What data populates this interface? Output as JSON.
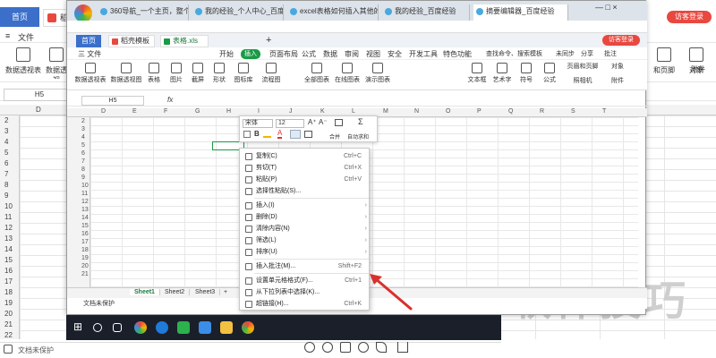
{
  "outer": {
    "tab_home": "首页",
    "tab_doc": "稻壳",
    "menu": [
      "文件"
    ],
    "ribbon": [
      "数据透视表",
      "数据透视"
    ],
    "namebox": "H5",
    "col_headers": [
      "D",
      "E"
    ],
    "row_numbers": [
      "2",
      "3",
      "4",
      "5",
      "6",
      "7",
      "8",
      "9",
      "10",
      "11",
      "12",
      "13",
      "14",
      "15",
      "16",
      "17",
      "18",
      "19",
      "20",
      "21",
      "22"
    ],
    "right_ribbon": [
      "和页脚",
      "对象",
      "附件"
    ],
    "user_badge": "访客登录",
    "status_doc": "文档未保护"
  },
  "viewer": {
    "watermark": "软件技巧",
    "bottom_icons": [
      "zoom-in-icon",
      "zoom-out-icon",
      "page-icon",
      "rotate-icon",
      "pen-icon",
      "download-icon"
    ]
  },
  "browser": {
    "tabs": [
      {
        "label": "360导航_一个主页，整个世界"
      },
      {
        "label": "我的经验_个人中心_百度经验"
      },
      {
        "label": "excel表格如何插入其他的表格"
      },
      {
        "label": "我的经验_百度经验"
      },
      {
        "label": "摘要编辑器_百度经验"
      }
    ],
    "win_controls": "—  □  ×"
  },
  "wps": {
    "tab_home": "首页",
    "tab_template": "稻壳模板",
    "tab_file": "表格.xls",
    "user_badge": "访客登录",
    "menu": [
      "三 文件",
      "开始",
      "插入",
      "页面布局",
      "公式",
      "数据",
      "审阅",
      "视图",
      "安全",
      "开发工具",
      "特色功能",
      "查找命令、搜索模板",
      "未同步",
      "分享",
      "批注"
    ],
    "ribbon": [
      "数据透视表",
      "数据透视图",
      "表格",
      "图片",
      "截屏",
      "形状",
      "图标库",
      "流程图",
      "全部图表",
      "在线图表",
      "演示图表",
      "文本框",
      "艺术字",
      "符号",
      "公式",
      "页眉和页脚",
      "对象",
      "照相机",
      "附件"
    ],
    "namebox": "H5",
    "fx": "fx",
    "col_headers": [
      "D",
      "E",
      "F",
      "G",
      "H",
      "I",
      "J",
      "K",
      "L",
      "M",
      "N",
      "O",
      "P",
      "Q",
      "R",
      "S",
      "T"
    ],
    "row_numbers": [
      "2",
      "3",
      "4",
      "5",
      "6",
      "7",
      "8",
      "9",
      "10",
      "11",
      "12",
      "13",
      "14",
      "15",
      "16",
      "17",
      "18",
      "19",
      "20",
      "21"
    ],
    "sheets": [
      "Sheet1",
      "Sheet2",
      "Sheet3"
    ],
    "status": "文档未保护"
  },
  "minitoolbar": {
    "font": "宋体",
    "size": "12",
    "grow": "A⁺",
    "shrink": "A⁻",
    "bold": "B",
    "merge": "合并",
    "autosum": "自动求和"
  },
  "context_menu": {
    "items": [
      {
        "label": "复制(C)",
        "shortcut": "Ctrl+C",
        "icon": "copy-icon"
      },
      {
        "label": "剪切(T)",
        "shortcut": "Ctrl+X",
        "icon": "cut-icon"
      },
      {
        "label": "粘贴(P)",
        "shortcut": "Ctrl+V",
        "icon": "paste-icon"
      },
      {
        "label": "选择性粘贴(S)...",
        "shortcut": "",
        "icon": "paste-special-icon"
      },
      {
        "label": "插入(I)",
        "shortcut": "",
        "icon": "insert-icon",
        "submenu": true
      },
      {
        "label": "删除(D)",
        "shortcut": "",
        "icon": "delete-icon",
        "submenu": true
      },
      {
        "label": "清除内容(N)",
        "shortcut": "",
        "icon": "clear-icon",
        "submenu": true
      },
      {
        "label": "筛选(L)",
        "shortcut": "",
        "icon": "filter-icon",
        "submenu": true
      },
      {
        "label": "排序(U)",
        "shortcut": "",
        "icon": "sort-icon",
        "submenu": true
      },
      {
        "label": "插入批注(M)...",
        "shortcut": "Shift+F2",
        "icon": "comment-icon"
      },
      {
        "label": "设置单元格格式(F)...",
        "shortcut": "Ctrl+1",
        "icon": "format-cells-icon"
      },
      {
        "label": "从下拉列表中选择(K)...",
        "shortcut": "",
        "icon": "dropdown-icon"
      },
      {
        "label": "超链接(H)...",
        "shortcut": "Ctrl+K",
        "icon": "link-icon"
      }
    ]
  },
  "colors": {
    "accent_green": "#1a9a46",
    "brand_red": "#e8483f",
    "home_blue": "#3b6fc9",
    "arrow_red": "#d9302c"
  }
}
